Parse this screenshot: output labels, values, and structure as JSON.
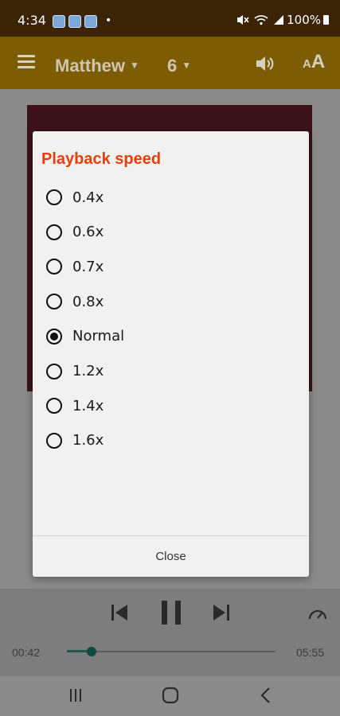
{
  "status_bar": {
    "time": "4:34",
    "dot": "•",
    "battery": "100%"
  },
  "toolbar": {
    "book": "Matthew",
    "chapter": "6",
    "textsize_large": "A",
    "textsize_small": "A"
  },
  "dialog": {
    "title": "Playback speed",
    "options": [
      {
        "label": "0.4x",
        "selected": false
      },
      {
        "label": "0.6x",
        "selected": false
      },
      {
        "label": "0.7x",
        "selected": false
      },
      {
        "label": "0.8x",
        "selected": false
      },
      {
        "label": "Normal",
        "selected": true
      },
      {
        "label": "1.2x",
        "selected": false
      },
      {
        "label": "1.4x",
        "selected": false
      },
      {
        "label": "1.6x",
        "selected": false
      }
    ],
    "close_label": "Close"
  },
  "player": {
    "elapsed": "00:42",
    "duration": "05:55",
    "progress_fraction": 0.118
  },
  "colors": {
    "title_accent": "#e4400f",
    "toolbar": "#7d5c06",
    "status_bar": "#3b2405"
  },
  "icons": {
    "menu": "menu-icon",
    "speaker": "speaker-icon",
    "text_size": "text-size-icon",
    "previous": "skip-previous-icon",
    "pause": "pause-icon",
    "next": "skip-next-icon",
    "speed": "speedometer-icon",
    "recents": "recents-icon",
    "home": "home-icon",
    "back": "back-icon"
  }
}
